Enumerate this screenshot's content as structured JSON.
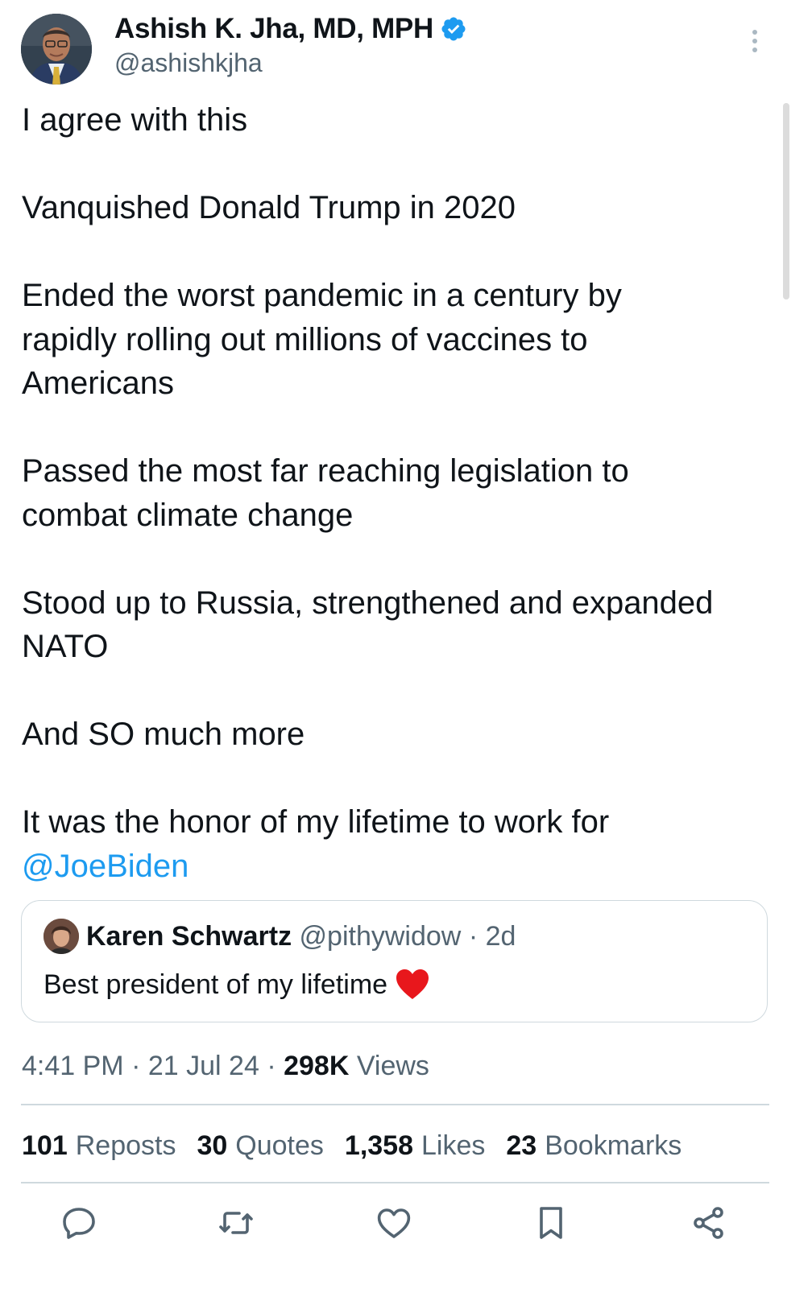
{
  "author": {
    "display_name": "Ashish K. Jha, MD, MPH",
    "handle": "@ashishkjha",
    "verified": true,
    "avatar_icon": "profile-photo"
  },
  "tweet": {
    "paragraphs": [
      "I agree with this",
      "Vanquished Donald Trump in 2020",
      "Ended the worst pandemic in a century by rapidly rolling out millions of vaccines to Americans",
      "Passed the most far reaching legislation to combat climate change",
      "Stood up to Russia, strengthened and expanded NATO",
      "And SO much more",
      "It was the honor of my lifetime to work for"
    ],
    "mention": "@JoeBiden"
  },
  "quoted_tweet": {
    "display_name": "Karen Schwartz",
    "handle": "@pithywidow",
    "separator": "·",
    "age": "2d",
    "text": "Best president of my lifetime",
    "emoji": "red-heart"
  },
  "meta": {
    "time": "4:41 PM",
    "separator": "·",
    "date": "21 Jul 24",
    "views_count": "298K",
    "views_label": "Views"
  },
  "stats": {
    "reposts_count": "101",
    "reposts_label": "Reposts",
    "quotes_count": "30",
    "quotes_label": "Quotes",
    "likes_count": "1,358",
    "likes_label": "Likes",
    "bookmarks_count": "23",
    "bookmarks_label": "Bookmarks"
  },
  "actions": [
    "reply-icon",
    "repost-icon",
    "like-icon",
    "bookmark-icon",
    "share-icon"
  ],
  "colors": {
    "text": "#0f1419",
    "secondary": "#536471",
    "link": "#1d9bf0",
    "border": "#cfd9de",
    "verified": "#1d9bf0"
  }
}
